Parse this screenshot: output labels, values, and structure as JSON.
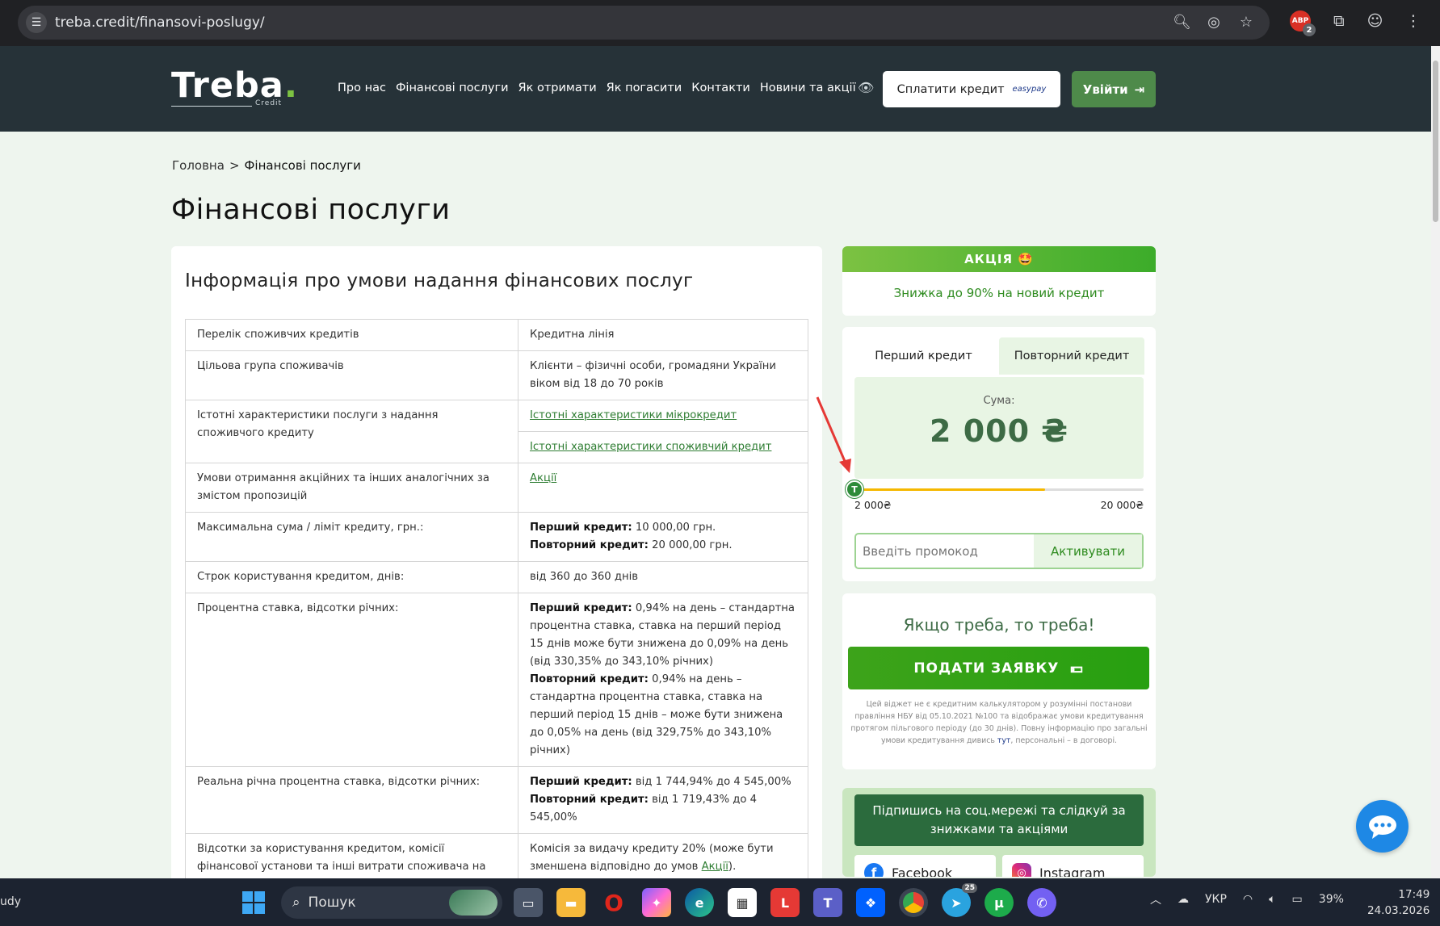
{
  "browser": {
    "url": "treba.credit/finansovi-poslugy/",
    "extension_badge": "2",
    "extension_label": "ABP"
  },
  "header": {
    "logo": "Treba",
    "logo_dot": ".",
    "logo_sub": "Credit",
    "nav": [
      "Про нас",
      "Фінансові послуги",
      "Як отримати",
      "Як погасити",
      "Контакти",
      "Новини та акції"
    ],
    "pay_button": "Сплатити кредит",
    "pay_logo": "easypay",
    "login_button": "Увійти"
  },
  "breadcrumb": {
    "home": "Головна",
    "separator": ">",
    "current": "Фінансові послуги"
  },
  "page_title": "Фінансові послуги",
  "info": {
    "title": "Інформація про умови надання фінансових послуг",
    "rows": [
      {
        "label": "Перелік споживчих кредитів",
        "value": "Кредитна лінія"
      },
      {
        "label": "Цільова група споживачів",
        "value": "Клієнти – фізичні особи, громадяни України віком від 18 до 70 років"
      },
      {
        "label": "Істотні характеристики послуги з надання споживчого кредиту",
        "link1": "Істотні характеристики мікрокредит",
        "link2": "Істотні характеристики споживчий кредит"
      },
      {
        "label": "Умови отримання акційних та інших аналогічних за змістом пропозицій",
        "link": "Акції"
      },
      {
        "label": "Максимальна сума / ліміт кредиту, грн.:",
        "b1": "Перший кредит:",
        "t1": " 10 000,00 грн.",
        "b2": "Повторний кредит:",
        "t2": " 20 000,00 грн."
      },
      {
        "label": "Строк користування кредитом, днів:",
        "value": "від 360 до 360 днів"
      },
      {
        "label": "Процентна ставка, відсотки річних:",
        "b1": "Перший кредит:",
        "t1": " 0,94% на день – стандартна процентна ставка, ставка на перший період 15 днів може бути знижена до 0,09% на день (від 330,35% до 343,10% річних)",
        "b2": "Повторний кредит:",
        "t2": " 0,94% на день – стандартна процентна ставка, ставка на перший період 15 днів – може бути знижена до 0,05% на день (від 329,75% до 343,10% річних)"
      },
      {
        "label": "Реальна річна процентна ставка, відсотки річних:",
        "b1": "Перший кредит:",
        "t1": " від 1 744,94% до 4 545,00%",
        "b2": "Повторний кредит:",
        "t2": " від 1 719,43% до 4 545,00%"
      },
      {
        "label": "Відсотки за користування кредитом, комісії фінансової установи та інші витрати споживача на супровідні послуги фінансової установи,кредитного посередника(за наявності) та третіх осіб:",
        "value": "Комісія за видачу кредиту 20% (може бути зменшена відповідно до умов ",
        "link": "Акції",
        "tail": ")."
      }
    ]
  },
  "promo": {
    "head": "АКЦІЯ 🤩",
    "text": "Знижка до 90% на новий кредит"
  },
  "calculator": {
    "tab_first": "Перший кредит",
    "tab_repeat": "Повторний кредит",
    "amount_label": "Сума:",
    "amount_value": "2 000 ₴",
    "slider_min": "2 000₴",
    "slider_max": "20 000₴",
    "slider_fraction": 0,
    "thumb_letter": "T",
    "promo_placeholder": "Введіть промокод",
    "promo_button": "Активувати"
  },
  "apply": {
    "slogan": "Якщо треба, то треба!",
    "button": "ПОДАТИ ЗАЯВКУ",
    "disclaimer": "Цей віджет не є кредитним калькулятором у розумінні постанови правління НБУ від 05.10.2021 №100 та відображає умови кредитування протягом пільгового періоду (до 30 днів). Повну інформацію про загальні умови кредитування дивись ",
    "disclaimer_link": "тут",
    "disclaimer_tail": ", персональні – в договорі."
  },
  "social": {
    "head": "Підпишись на соц.мережі та слідкуй за знижками та акціями",
    "facebook": "Facebook",
    "instagram": "Instagram"
  },
  "taskbar": {
    "left_text": "udy",
    "search": "Пошук",
    "telegram_badge": "25",
    "lang": "УКР",
    "battery": "39%",
    "time": "17:49",
    "date": "24.03.2026"
  },
  "colors": {
    "header_bg": "#263238",
    "accent_green": "#4e8a4a",
    "promo_green": "#3cac2a",
    "slider_fill": "#f5b800",
    "annotation_red": "#e53935"
  }
}
